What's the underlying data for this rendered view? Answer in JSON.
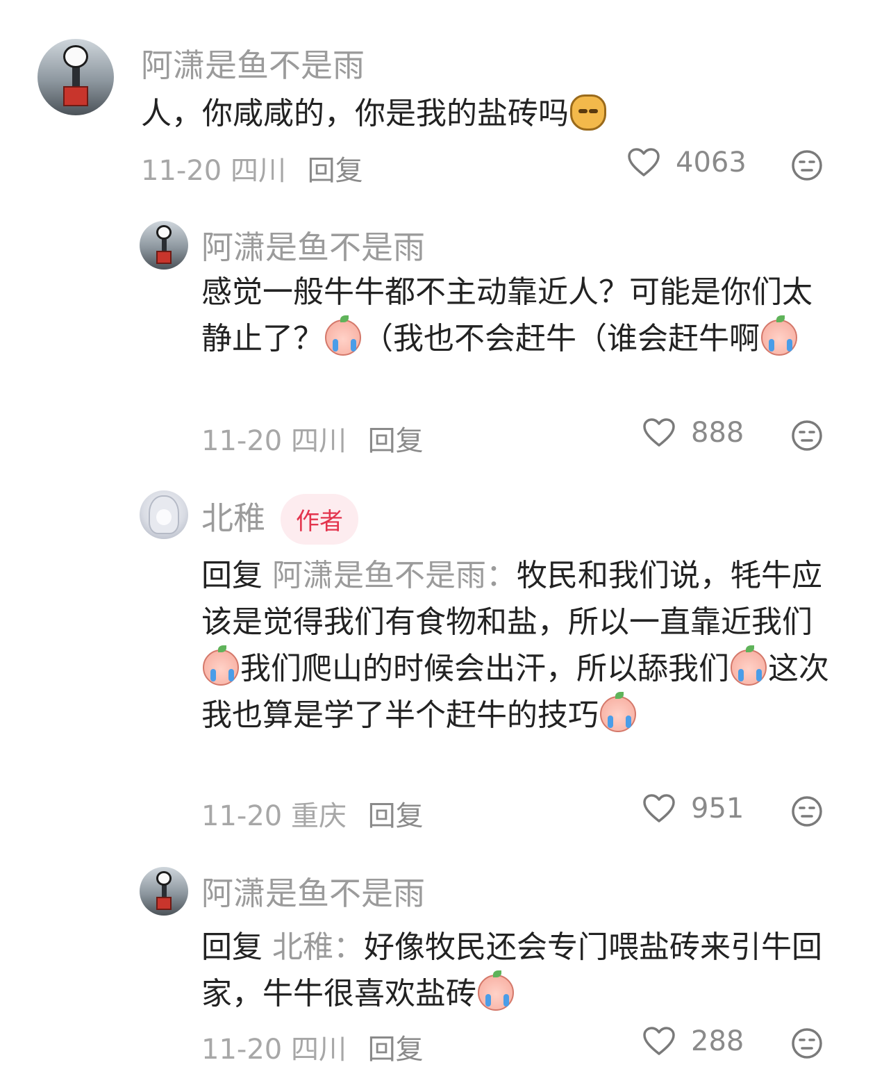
{
  "comments": [
    {
      "user": "阿潇是鱼不是雨",
      "text_a": "人，你咸咸的，你是我的盐砖吗",
      "date": "11-20",
      "location": "四川",
      "reply_label": "回复",
      "likes": "4063"
    },
    {
      "user": "阿潇是鱼不是雨",
      "text_a": "感觉一般牛牛都不主动靠近人？可能是你们太静止了？",
      "text_b": "（我也不会赶牛（谁会赶牛啊",
      "date": "11-20",
      "location": "四川",
      "reply_label": "回复",
      "likes": "888"
    },
    {
      "user": "北稚",
      "badge": "作者",
      "reply_prefix": "回复",
      "reply_to": "阿潇是鱼不是雨：",
      "text_a": "牧民和我们说，牦牛应该是觉得我们有食物和盐，所以一直靠近我们",
      "text_b": "我们爬山的时候会出汗，所以舔我们",
      "text_c": "这次我也算是学了半个赶牛的技巧",
      "date": "11-20",
      "location": "重庆",
      "reply_label": "回复",
      "likes": "951"
    },
    {
      "user": "阿潇是鱼不是雨",
      "reply_prefix": "回复",
      "reply_to": "北稚：",
      "text_a": "好像牧民还会专门喂盐砖来引牛回家，牛牛很喜欢盐砖",
      "date": "11-20",
      "location": "四川",
      "reply_label": "回复",
      "likes": "288"
    }
  ],
  "icons": {
    "like": "heart-outline-icon",
    "dislike": "neutral-face-icon",
    "emoji_dog": "doge-emoji",
    "emoji_peach": "crying-peach-emoji"
  },
  "colors": {
    "name": "#9b9b9b",
    "text": "#222222",
    "meta": "#a7a7a7",
    "author_badge_bg": "#fdecef",
    "author_badge_text": "#e3344d"
  }
}
